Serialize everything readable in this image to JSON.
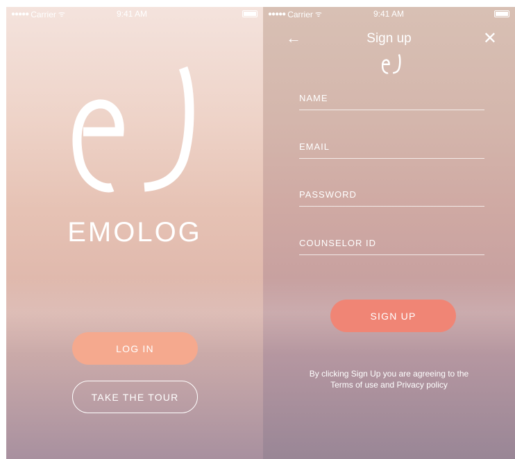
{
  "status_bar": {
    "carrier": "Carrier",
    "time": "9:41 AM"
  },
  "welcome": {
    "brand": "EMOLOG",
    "login_label": "LOG IN",
    "tour_label": "TAKE THE TOUR"
  },
  "signup": {
    "title": "Sign up",
    "back_icon": "←",
    "close_icon": "✕",
    "fields": {
      "name": "NAME",
      "email": "EMAIL",
      "password": "PASSWORD",
      "counselor_id": "COUNSELOR ID"
    },
    "signup_label": "SIGN UP",
    "terms_line1": "By clicking Sign Up you are agreeing to the",
    "terms_link": "Terms of use",
    "terms_and": " and ",
    "privacy_link": "Privacy policy"
  },
  "icons": {
    "logo": "ej-logo-icon",
    "wifi": "wifi-icon",
    "battery": "battery-icon"
  },
  "colors": {
    "login_button": "#f5a98e",
    "signup_button": "#f08575",
    "text": "#ffffff"
  }
}
